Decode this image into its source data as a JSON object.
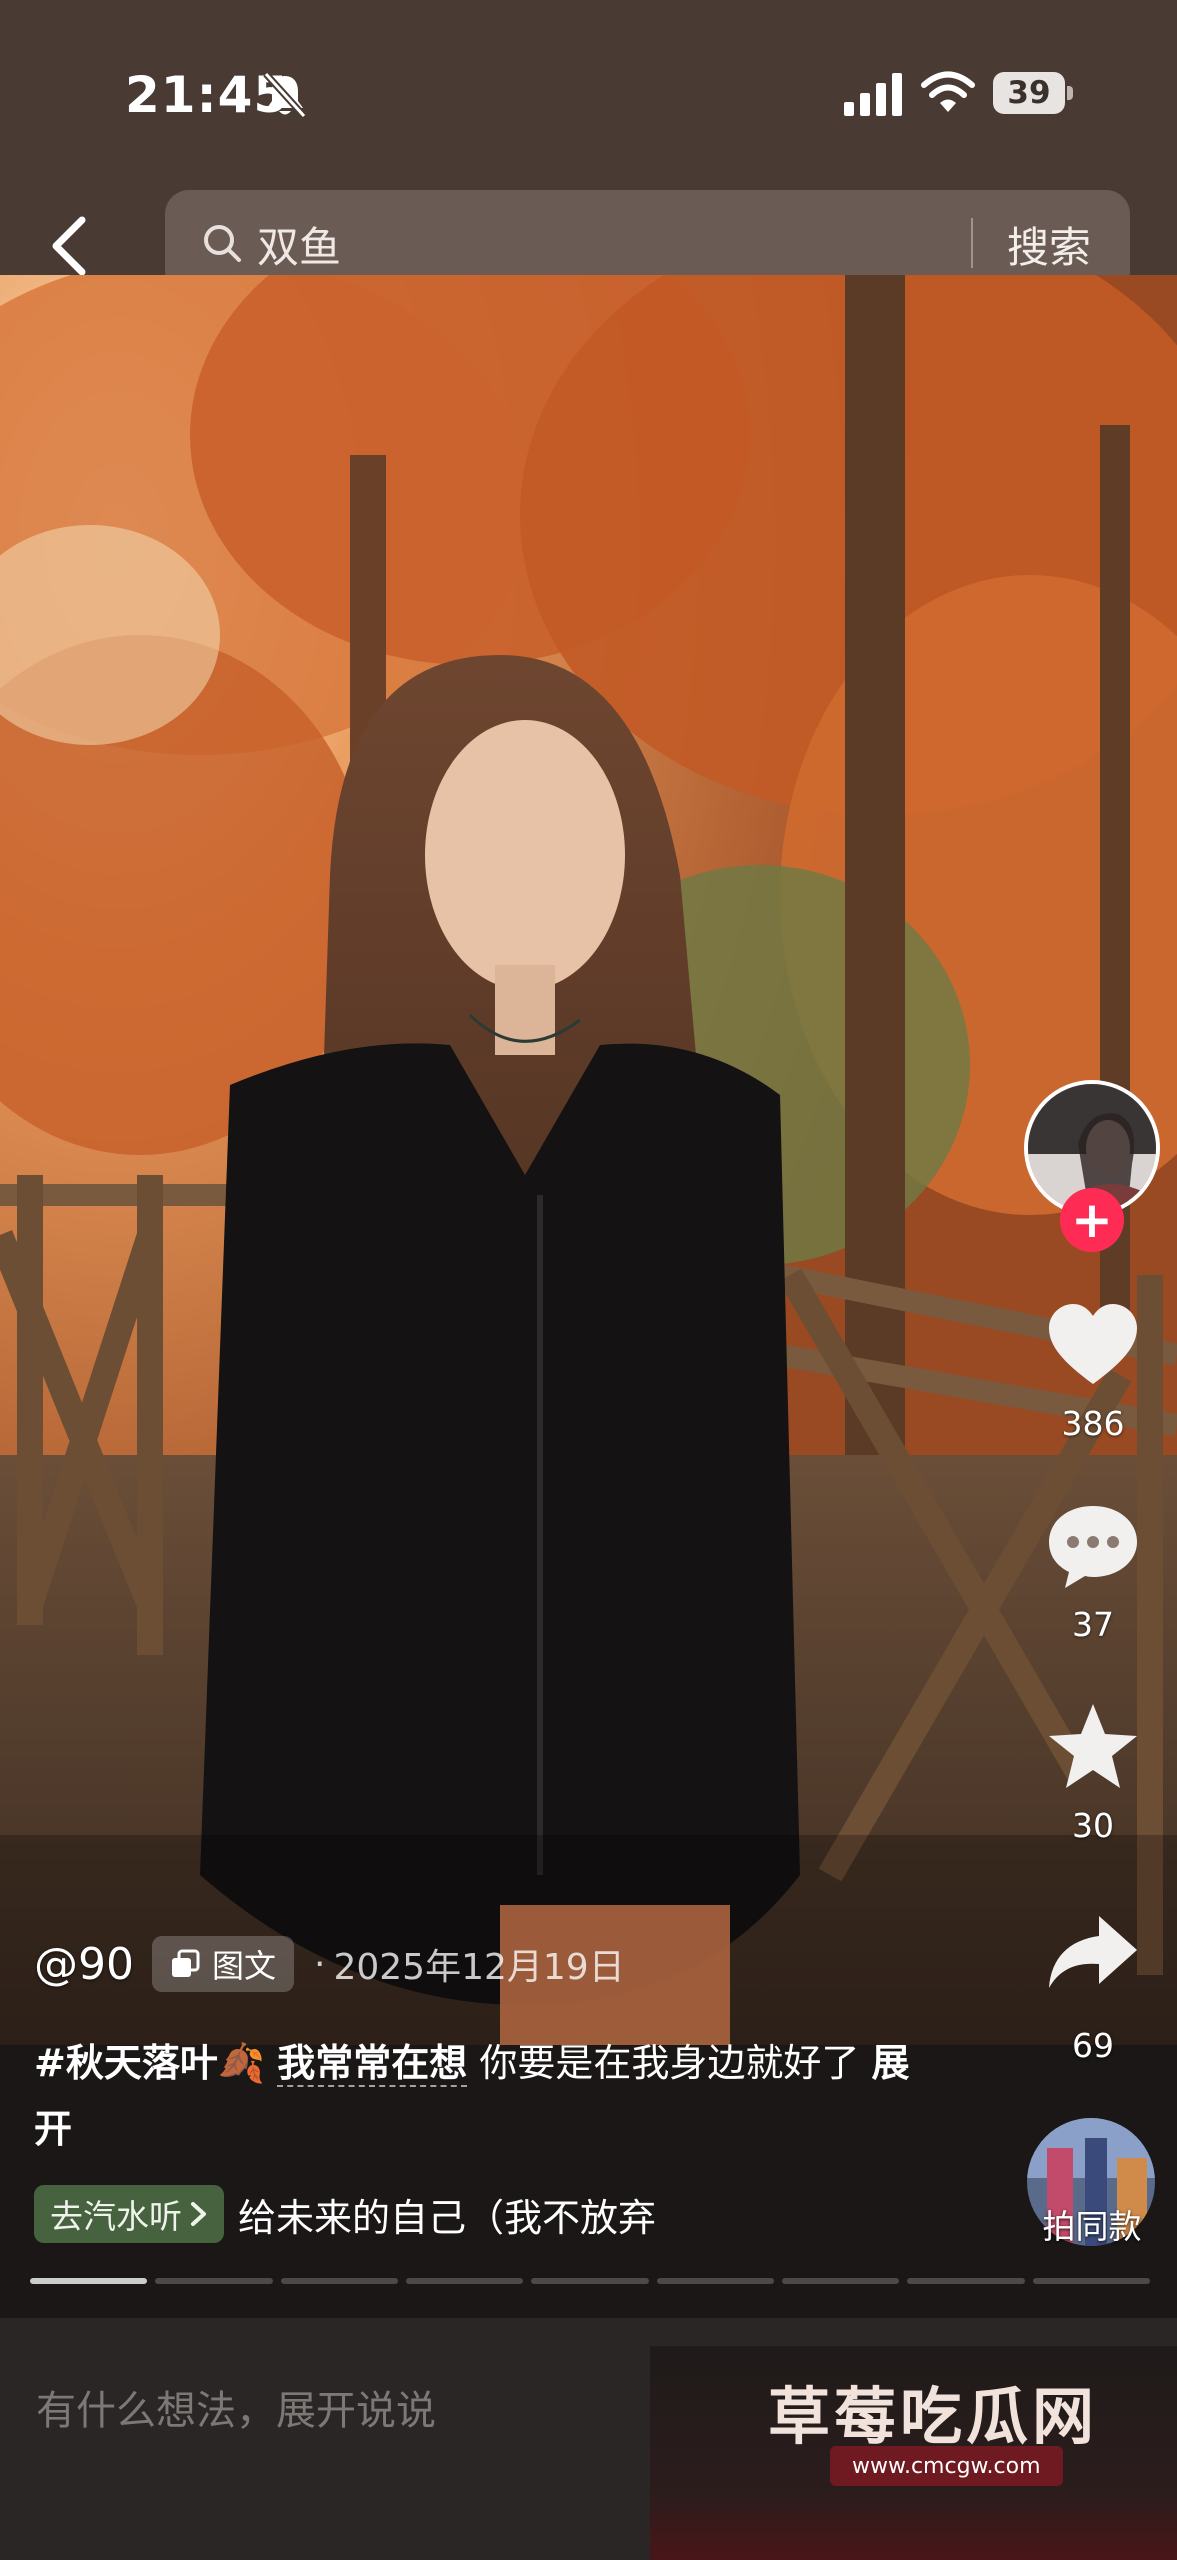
{
  "status_bar": {
    "time": "21:45",
    "battery": "39"
  },
  "search": {
    "query": "双鱼",
    "button": "搜索"
  },
  "post": {
    "author": "@90",
    "type_label": "图文",
    "date_sep": "·",
    "date": "2025年12月19日",
    "caption_tag": "#秋天落叶🍂",
    "caption_topic": "我常常在想",
    "caption_text": " 你要是在我身边就好了",
    "caption_more": "展开",
    "music_button": "去汽水听",
    "music_title": "给未来的自己（我不放弃",
    "image_pages": 9,
    "current_page": 1
  },
  "actions": {
    "likes": "386",
    "comments": "37",
    "favorites": "30",
    "shares": "69",
    "remix_label": "拍同款"
  },
  "comment_bar": {
    "placeholder": "有什么想法，展开说说"
  },
  "watermark": {
    "title": "草莓吃瓜网",
    "url": "www.cmcgw.com"
  },
  "icons": [
    "bell-slash-icon",
    "signal-icon",
    "wifi-icon",
    "battery-icon",
    "back-icon",
    "search-icon",
    "plus-icon",
    "heart-icon",
    "comment-icon",
    "star-icon",
    "share-icon",
    "image-post-icon",
    "chevron-right-icon"
  ],
  "colors": {
    "accent": "#fe2c55",
    "music_badge": "#507046",
    "top_bar": "#4a3a34"
  }
}
